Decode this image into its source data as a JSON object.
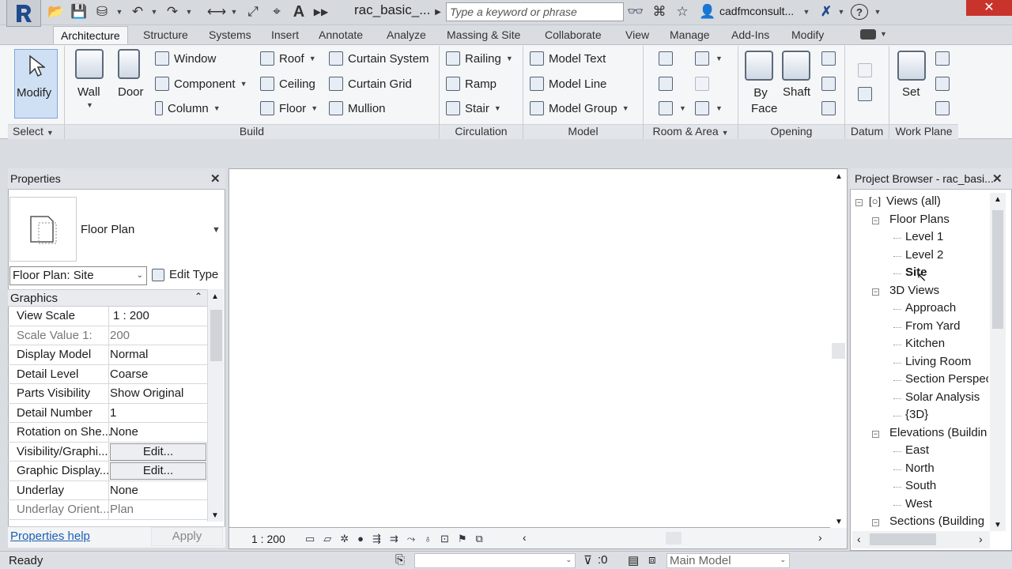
{
  "title_bar": {
    "doc_title": "rac_basic_...",
    "search_placeholder": "Type a keyword or phrase",
    "user": "cadfmconsult...",
    "close_label": "✕",
    "text_icon": "A",
    "help_icon": "?"
  },
  "tabs": [
    "Architecture",
    "Structure",
    "Systems",
    "Insert",
    "Annotate",
    "Analyze",
    "Massing & Site",
    "Collaborate",
    "View",
    "Manage",
    "Add-Ins",
    "Modify"
  ],
  "ribbon": {
    "modify": "Modify",
    "select": "Select",
    "wall": "Wall",
    "door": "Door",
    "build": {
      "col1": [
        "Window",
        "Component",
        "Column"
      ],
      "col2": [
        "Roof",
        "Ceiling",
        "Floor"
      ],
      "col3": [
        "Curtain System",
        "Curtain Grid",
        "Mullion"
      ]
    },
    "circulation": [
      "Railing",
      "Ramp",
      "Stair"
    ],
    "model": [
      "Model Text",
      "Model Line",
      "Model Group"
    ],
    "opening": {
      "by_face": "By Face",
      "shaft": "Shaft"
    },
    "workplane": {
      "set": "Set"
    },
    "panels": {
      "select": "Select",
      "build": "Build",
      "circulation": "Circulation",
      "model": "Model",
      "room_area": "Room & Area",
      "opening": "Opening",
      "datum": "Datum",
      "work_plane": "Work Plane"
    }
  },
  "properties": {
    "title": "Properties",
    "type_name": "Floor Plan",
    "instance_selector": "Floor Plan: Site",
    "edit_type": "Edit Type",
    "group": "Graphics",
    "rows": [
      {
        "k": "View Scale",
        "v": "1 : 200"
      },
      {
        "k": "Scale Value    1:",
        "v": "200"
      },
      {
        "k": "Display Model",
        "v": "Normal"
      },
      {
        "k": "Detail Level",
        "v": "Coarse"
      },
      {
        "k": "Parts Visibility",
        "v": "Show Original"
      },
      {
        "k": "Detail Number",
        "v": "1"
      },
      {
        "k": "Rotation on She...",
        "v": "None"
      },
      {
        "k": "Visibility/Graphi...",
        "v": "Edit..."
      },
      {
        "k": "Graphic Display...",
        "v": "Edit..."
      },
      {
        "k": "Underlay",
        "v": "None"
      },
      {
        "k": "Underlay Orient...",
        "v": "Plan"
      }
    ],
    "help": "Properties help",
    "apply": "Apply"
  },
  "viewbar": {
    "scale": "1 : 200"
  },
  "browser": {
    "title": "Project Browser - rac_basi...",
    "nodes": [
      {
        "label": "Views (all)",
        "level": 0
      },
      {
        "label": "Floor Plans",
        "level": 1
      },
      {
        "label": "Level 1",
        "level": 2
      },
      {
        "label": "Level 2",
        "level": 2
      },
      {
        "label": "Site",
        "level": 2
      },
      {
        "label": "3D Views",
        "level": 1
      },
      {
        "label": "Approach",
        "level": 2
      },
      {
        "label": "From Yard",
        "level": 2
      },
      {
        "label": "Kitchen",
        "level": 2
      },
      {
        "label": "Living Room",
        "level": 2
      },
      {
        "label": "Section Perspec",
        "level": 2
      },
      {
        "label": "Solar Analysis",
        "level": 2
      },
      {
        "label": "{3D}",
        "level": 2
      },
      {
        "label": "Elevations (Buildin",
        "level": 1
      },
      {
        "label": "East",
        "level": 2
      },
      {
        "label": "North",
        "level": 2
      },
      {
        "label": "South",
        "level": 2
      },
      {
        "label": "West",
        "level": 2
      },
      {
        "label": "Sections (Building",
        "level": 1
      }
    ]
  },
  "status": {
    "text": "Ready",
    "filter_count": ":0",
    "model": "Main Model"
  }
}
